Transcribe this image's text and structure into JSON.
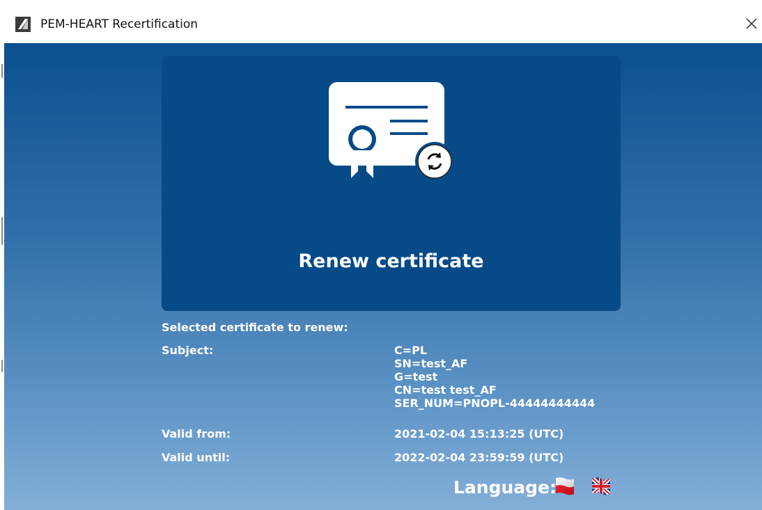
{
  "window": {
    "title": "PEM-HEART Recertification",
    "close_glyph": "✕"
  },
  "renew": {
    "label": "Renew certificate",
    "icon": "certificate-renew-icon"
  },
  "certificate": {
    "heading": "Selected certificate to renew:",
    "subject_label": "Subject:",
    "subject_lines": [
      "C=PL",
      "SN=test_AF",
      "G=test",
      "CN=test test_AF",
      "SER_NUM=PNOPL-44444444444"
    ],
    "valid_from_label": "Valid from:",
    "valid_from_value": "2021-02-04 15:13:25 (UTC)",
    "valid_until_label": "Valid until:",
    "valid_until_value": "2022-02-04 23:59:59 (UTC)"
  },
  "language": {
    "label": "Language:",
    "options": [
      "polish-flag-icon",
      "uk-flag-icon"
    ]
  },
  "colors": {
    "tile": "#064a88",
    "gradient_top": "#0a4f8e",
    "gradient_bottom": "#84afd8",
    "text": "#ffffff"
  }
}
